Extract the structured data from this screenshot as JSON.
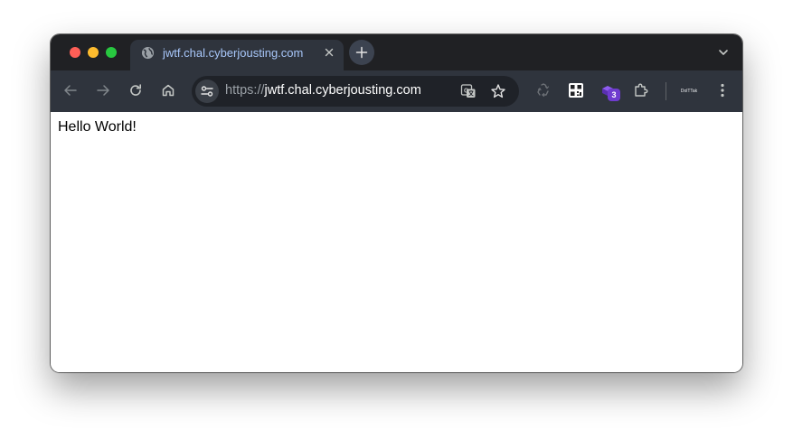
{
  "colors": {
    "tabstrip_bg": "#202124",
    "toolbar_bg": "#2f343d",
    "tab_title": "#a8c7fa",
    "extension_badge": "#6f3ccf"
  },
  "tab": {
    "title": "jwtf.chal.cyberjousting.com",
    "favicon": "globe-icon"
  },
  "address_bar": {
    "scheme": "https://",
    "host": "jwtf.chal.cyberjousting.com"
  },
  "extensions": {
    "badge_count": "3",
    "profile_label": "DolTTak"
  },
  "page": {
    "body_text": "Hello World!"
  }
}
